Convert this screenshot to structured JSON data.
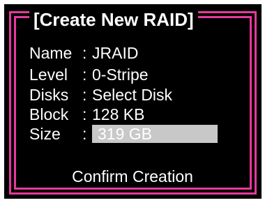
{
  "dialog": {
    "title": "[Create New RAID]"
  },
  "fields": [
    {
      "label": "Name",
      "separator": ":",
      "value": "JRAID"
    },
    {
      "label": "Level",
      "separator": ":",
      "value": "0-Stripe"
    },
    {
      "label": "Disks",
      "separator": ":",
      "value": "Select Disk"
    },
    {
      "label": "Block",
      "separator": ":",
      "value": "128 KB"
    },
    {
      "label": "Size",
      "separator": ":",
      "value": "319 GB"
    }
  ],
  "actions": {
    "confirm_label": "Confirm Creation"
  },
  "colors": {
    "background": "#000000",
    "frame": "#e6399b",
    "text": "#ffffff",
    "highlight": "#c8c8c8"
  }
}
